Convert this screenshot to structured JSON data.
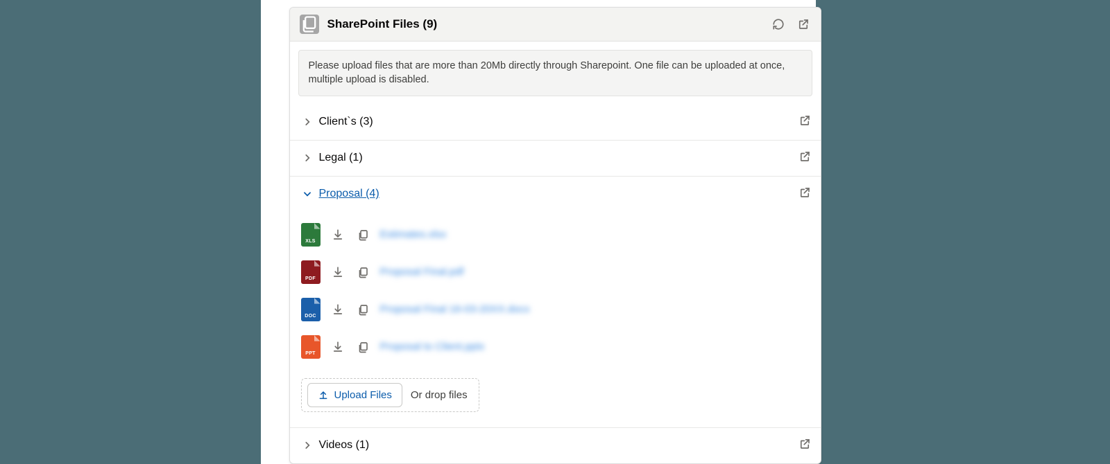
{
  "header": {
    "title": "SharePoint Files (9)"
  },
  "notice": "Please upload files that are more than 20Mb directly through Sharepoint. One file can be uploaded at once, multiple upload is disabled.",
  "folders": [
    {
      "label": "Client`s (3)",
      "expanded": false
    },
    {
      "label": "Legal (1)",
      "expanded": false
    },
    {
      "label": "Proposal (4)",
      "expanded": true
    },
    {
      "label": "Videos (1)",
      "expanded": false
    }
  ],
  "proposal_files": [
    {
      "type": "xls",
      "ext": "XLS",
      "name": "Estimates.xlsx"
    },
    {
      "type": "pdf",
      "ext": "PDF",
      "name": "Proposal Final.pdf"
    },
    {
      "type": "doc",
      "ext": "DOC",
      "name": "Proposal Final 16-03-20XX.docx"
    },
    {
      "type": "ppt",
      "ext": "PPT",
      "name": "Proposal to Client.pptx"
    }
  ],
  "upload": {
    "button_label": "Upload Files",
    "drop_hint": "Or drop files"
  }
}
